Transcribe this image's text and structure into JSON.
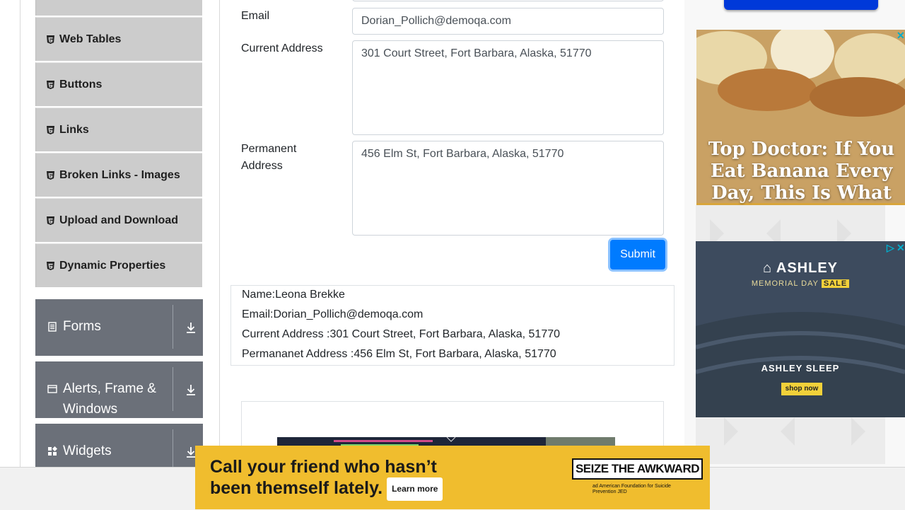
{
  "sidebar": {
    "elements_items": [
      {
        "label": "Web Tables"
      },
      {
        "label": "Buttons"
      },
      {
        "label": "Links"
      },
      {
        "label": "Broken Links - Images"
      },
      {
        "label": "Upload and Download"
      },
      {
        "label": "Dynamic Properties"
      }
    ],
    "groups": [
      {
        "label": "Forms"
      },
      {
        "label": "Alerts, Frame &",
        "label2": "Windows"
      },
      {
        "label": "Widgets"
      }
    ]
  },
  "form": {
    "email_label": "Email",
    "email_value": "Dorian_Pollich@demoqa.com",
    "current_address_label": "Current Address",
    "current_address_value": "301 Court Street, Fort Barbara, Alaska, 51770",
    "permanent_address_label_line1": "Permanent",
    "permanent_address_label_line2": "Address",
    "permanent_address_value": "456 Elm St, Fort Barbara, Alaska, 51770",
    "submit_label": "Submit"
  },
  "output": {
    "name": "Name:Leona Brekke",
    "email": "Email:Dorian_Pollich@demoqa.com",
    "current_address": "Current Address :301 Court Street, Fort Barbara, Alaska, 51770",
    "permanent_address": "Permananet Address :456 Elm St, Fort Barbara, Alaska, 51770"
  },
  "ads": {
    "banana_headline": "Top Doctor: If You Eat Banana Every Day, This Is What Happens",
    "ashley_brand": "ASHLEY",
    "ashley_memorial": "MEMORIAL DAY",
    "ashley_sale": "SALE",
    "ashley_sleep": "ASHLEY SLEEP",
    "ashley_shop": "shop now",
    "bottom_line1": "Call your friend who hasn’t",
    "bottom_line2": "been themself lately.",
    "bottom_learn": "Learn more",
    "bottom_seize": "SEIZE THE AWKWARD",
    "bottom_logos": "ad  American Foundation for Suicide Prevention  JED"
  },
  "colors": {
    "accent": "#007bff",
    "sidebar_item_bg": "#cccccc",
    "group_bg": "#6b7079",
    "bottom_ad_bg": "#f0bd2e"
  },
  "icons": {
    "element_item_icon": "html5-icon",
    "forms_icon": "document-icon",
    "alerts_icon": "window-icon",
    "widgets_icon": "widgets-icon",
    "expand_icon": "download-arrow-icon",
    "ad_close_icon": "close-icon"
  }
}
